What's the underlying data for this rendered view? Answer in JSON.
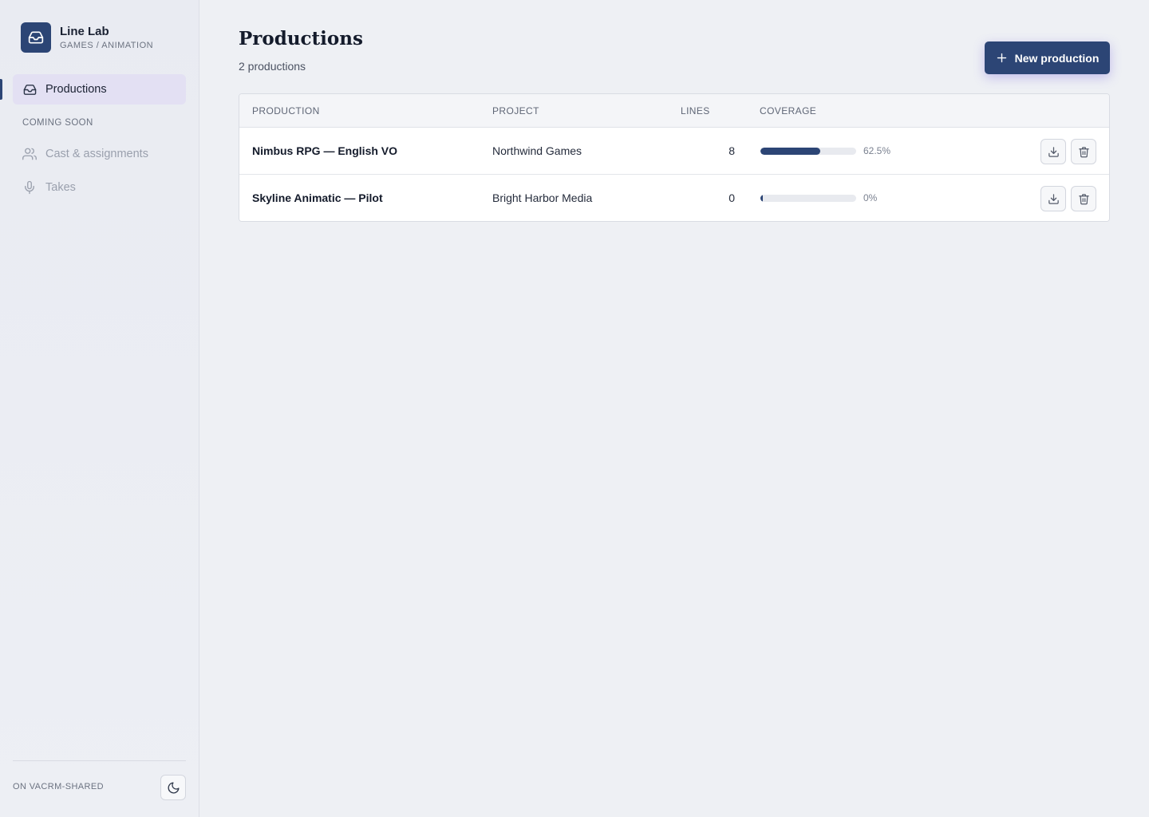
{
  "brand": {
    "name": "Line Lab",
    "subtitle": "GAMES / ANIMATION"
  },
  "nav": {
    "active": {
      "label": "Productions",
      "icon": "inbox-icon"
    },
    "section_label": "COMING SOON",
    "disabled_items": [
      {
        "label": "Cast & assignments",
        "icon": "users-icon"
      },
      {
        "label": "Takes",
        "icon": "microphone-icon"
      }
    ]
  },
  "footer": {
    "workspace": "ON VACRM-SHARED",
    "theme_icon": "moon-icon"
  },
  "header": {
    "title": "Productions",
    "count": "2 productions",
    "new_button": "New production"
  },
  "table": {
    "columns": [
      "PRODUCTION",
      "PROJECT",
      "LINES",
      "COVERAGE"
    ],
    "rows": [
      {
        "production": "Nimbus RPG — English VO",
        "project": "Northwind Games",
        "lines": "8",
        "coverage": 62.5,
        "coverage_label": "62.5%"
      },
      {
        "production": "Skyline Animatic — Pilot",
        "project": "Bright Harbor Media",
        "lines": "0",
        "coverage": 0,
        "coverage_label": "0%"
      }
    ]
  },
  "colors": {
    "accent": "#2c4575",
    "active_nav_bg": "#e3e0f3",
    "background": "#eef0f4"
  }
}
